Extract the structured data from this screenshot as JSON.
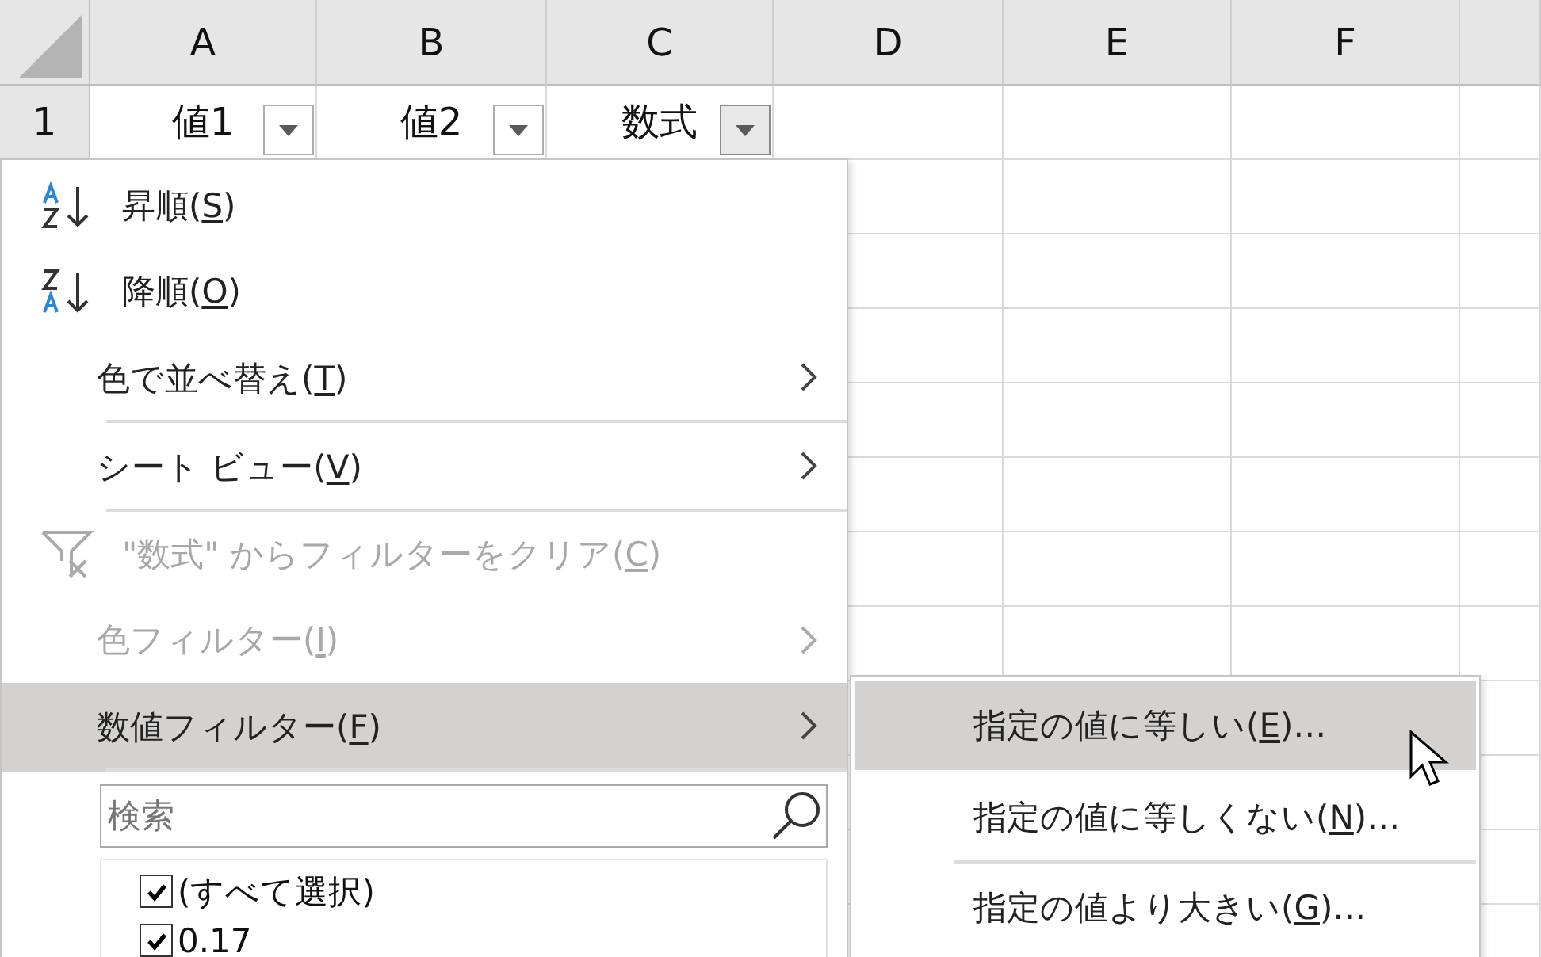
{
  "sheet": {
    "columns": [
      "A",
      "B",
      "C",
      "D",
      "E",
      "F"
    ],
    "row_number": "1",
    "header_cells": [
      {
        "text": "値1",
        "selected": false
      },
      {
        "text": "値2",
        "selected": false
      },
      {
        "text": "数式",
        "selected": true
      }
    ]
  },
  "menu": {
    "items": [
      {
        "kind": "sort_ascending",
        "text": "昇順(",
        "accel": "S",
        "tail": ")",
        "has_submenu": false,
        "disabled": false,
        "selected": false,
        "separator_after": false
      },
      {
        "kind": "sort_descending",
        "text": "降順(",
        "accel": "O",
        "tail": ")",
        "has_submenu": false,
        "disabled": false,
        "selected": false,
        "separator_after": false
      },
      {
        "kind": "plain",
        "text": "色で並べ替え(",
        "accel": "T",
        "tail": ")",
        "has_submenu": true,
        "disabled": false,
        "selected": false,
        "separator_after": true
      },
      {
        "kind": "plain",
        "text": "シート ビュー(",
        "accel": "V",
        "tail": ")",
        "has_submenu": true,
        "disabled": false,
        "selected": false,
        "separator_after": true
      },
      {
        "kind": "clear_filter",
        "text": "\"数式\" からフィルターをクリア(",
        "accel": "C",
        "tail": ")",
        "has_submenu": false,
        "disabled": true,
        "selected": false,
        "separator_after": false
      },
      {
        "kind": "plain",
        "text": "色フィルター(",
        "accel": "I",
        "tail": ")",
        "has_submenu": true,
        "disabled": true,
        "selected": false,
        "separator_after": false
      },
      {
        "kind": "plain",
        "text": "数値フィルター(",
        "accel": "F",
        "tail": ")",
        "has_submenu": true,
        "disabled": false,
        "selected": true,
        "separator_after": true
      }
    ],
    "search": {
      "placeholder": "検索"
    },
    "values": [
      {
        "label": "(すべて選択)",
        "checked": true
      },
      {
        "label": "0.17",
        "checked": true
      }
    ]
  },
  "submenu": {
    "items": [
      {
        "text": "指定の値に等しい(",
        "accel": "E",
        "tail": ")…",
        "selected": true,
        "separator_after": false
      },
      {
        "text": "指定の値に等しくない(",
        "accel": "N",
        "tail": ")…",
        "selected": false,
        "separator_after": true
      },
      {
        "text": "指定の値より大きい(",
        "accel": "G",
        "tail": ")…",
        "selected": false,
        "separator_after": false
      }
    ]
  }
}
